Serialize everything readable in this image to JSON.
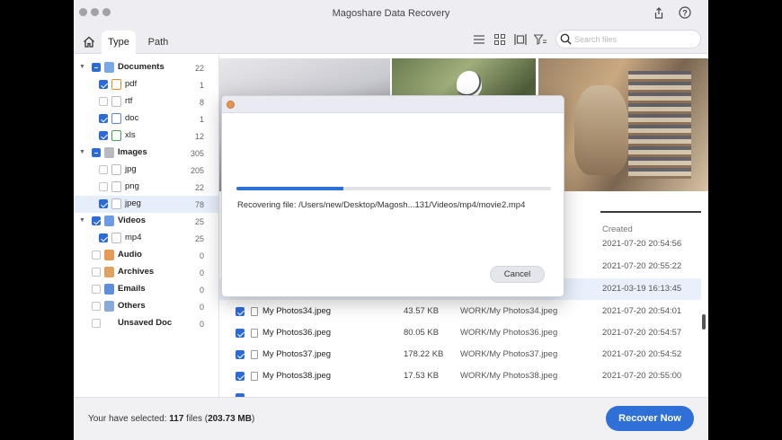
{
  "window": {
    "title": "Magoshare Data Recovery"
  },
  "colors": {
    "accent": "#2f6fd8",
    "selection": "#e6eefb",
    "close_dot": "#e39650"
  },
  "icons": {
    "share": "share-icon",
    "help": "help-icon",
    "home": "home-icon",
    "list_view": "list-view-icon",
    "grid_view": "grid-view-icon",
    "preview_view": "preview-view-icon",
    "filter": "filter-icon",
    "search": "search-icon",
    "file": "file-icon"
  },
  "tabs": [
    {
      "label": "Type",
      "active": true
    },
    {
      "label": "Path",
      "active": false
    }
  ],
  "search": {
    "placeholder": "Search files",
    "value": ""
  },
  "sidebar": {
    "documents": {
      "label": "Documents",
      "count": "22"
    },
    "pdf": {
      "label": "pdf",
      "count": "1"
    },
    "rtf": {
      "label": "rtf",
      "count": "8"
    },
    "doc": {
      "label": "doc",
      "count": "1"
    },
    "xls": {
      "label": "xls",
      "count": "12"
    },
    "images": {
      "label": "Images",
      "count": "305"
    },
    "jpg": {
      "label": "jpg",
      "count": "205"
    },
    "png": {
      "label": "png",
      "count": "22"
    },
    "jpeg": {
      "label": "jpeg",
      "count": "78"
    },
    "videos": {
      "label": "Videos",
      "count": "25"
    },
    "mp4": {
      "label": "mp4",
      "count": "25"
    },
    "audio": {
      "label": "Audio",
      "count": "0"
    },
    "archives": {
      "label": "Archives",
      "count": "0"
    },
    "emails": {
      "label": "Emails",
      "count": "0"
    },
    "others": {
      "label": "Others",
      "count": "0"
    },
    "unsaved": {
      "label": "Unsaved Doc",
      "count": "0"
    }
  },
  "table": {
    "created_header": "Created",
    "partial_dates": [
      "2021-07-20 20:54:56",
      "2021-07-20 20:55:22",
      "2021-03-19 16:13:45"
    ],
    "rows": [
      {
        "name": "My Photos34.jpeg",
        "size": "43.57 KB",
        "path": "WORK/My Photos34.jpeg",
        "created": "2021-07-20 20:54:01"
      },
      {
        "name": "My Photos36.jpeg",
        "size": "80.05 KB",
        "path": "WORK/My Photos36.jpeg",
        "created": "2021-07-20 20:54:57"
      },
      {
        "name": "My Photos37.jpeg",
        "size": "178.22 KB",
        "path": "WORK/My Photos37.jpeg",
        "created": "2021-07-20 20:54:52"
      },
      {
        "name": "My Photos38.jpeg",
        "size": "17.53 KB",
        "path": "WORK/My Photos38.jpeg",
        "created": "2021-07-20 20:55:00"
      }
    ]
  },
  "footer": {
    "prefix": "Your have selected: ",
    "count": "117",
    "files_word": " files (",
    "size": "203.73 MB",
    "suffix": ")",
    "recover_label": "Recover Now"
  },
  "dialog": {
    "progress": 0.34,
    "recovering_label": "Recovering file:",
    "recovering_path": "/Users/new/Desktop/Magosh...131/Videos/mp4/movie2.mp4",
    "cancel_label": "Cancel"
  }
}
